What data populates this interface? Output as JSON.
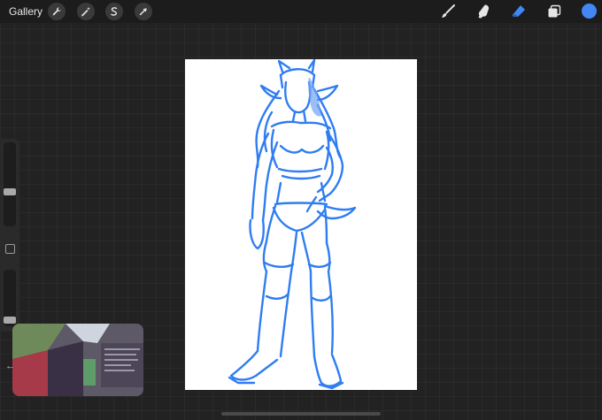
{
  "toolbar": {
    "gallery_label": "Gallery",
    "left_tools": [
      {
        "name": "actions",
        "icon": "wrench-icon"
      },
      {
        "name": "adjustments",
        "icon": "magic-wand-icon"
      },
      {
        "name": "selection",
        "icon": "selection-s-icon"
      },
      {
        "name": "transform",
        "icon": "transform-arrow-icon"
      }
    ],
    "right_tools": [
      {
        "name": "brush",
        "icon": "brush-icon"
      },
      {
        "name": "smudge",
        "icon": "smudge-icon"
      },
      {
        "name": "eraser",
        "icon": "eraser-icon",
        "active": true
      },
      {
        "name": "layers",
        "icon": "layers-icon"
      },
      {
        "name": "color",
        "icon": "color-swatch"
      }
    ],
    "accent_color": "#4287f5",
    "active_color": "#3b82f0"
  },
  "sidebar": {
    "brush_size_level": 0.6,
    "opacity_level": 0.95
  },
  "canvas": {
    "background": "#ffffff",
    "stroke_color": "#2f7df2"
  },
  "pip_video": {
    "description_colors": [
      "#6f8a5a",
      "#a63a48",
      "#3a3046",
      "#cfd5de"
    ]
  }
}
